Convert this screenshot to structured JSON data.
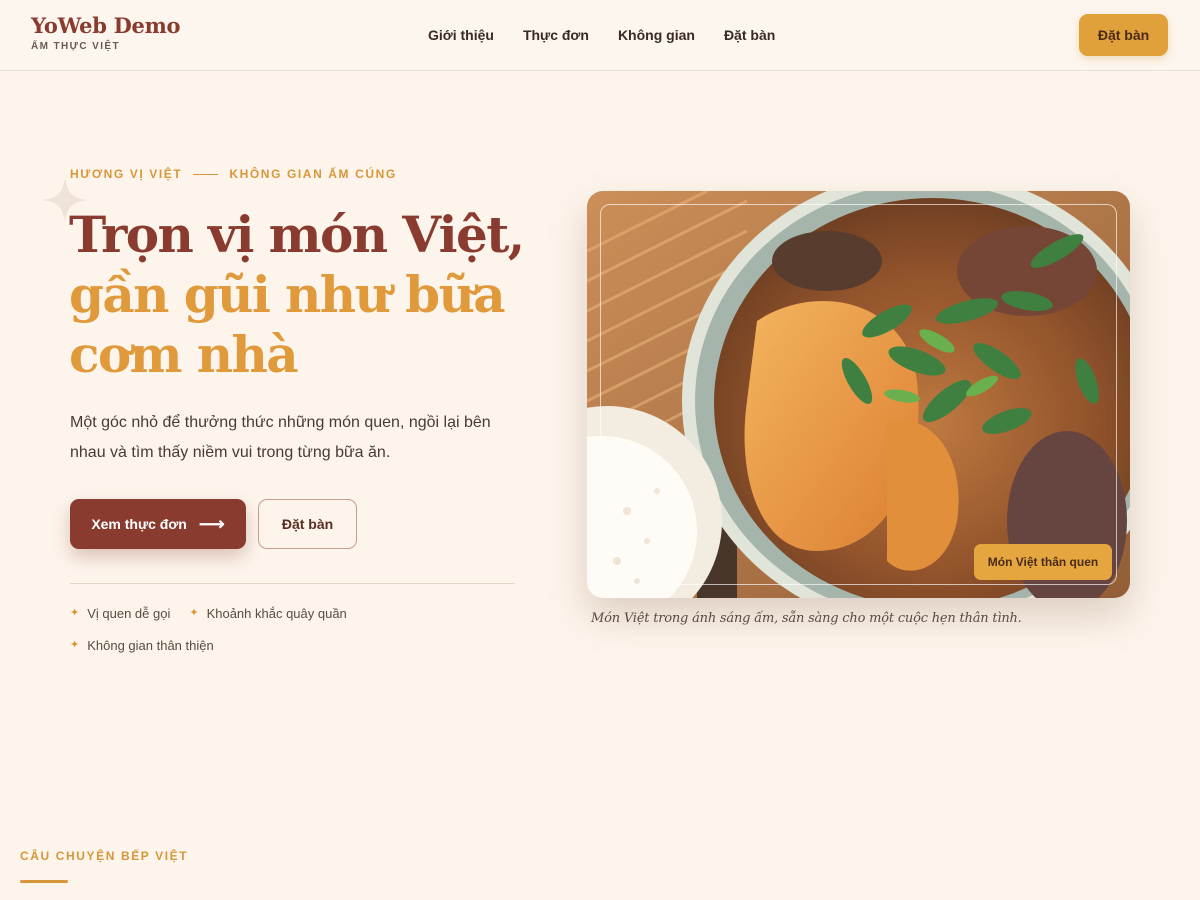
{
  "brand": {
    "name": "YoWeb Demo",
    "tagline": "ẨM THỰC VIỆT"
  },
  "nav": {
    "items": [
      "Giới thiệu",
      "Thực đơn",
      "Không gian",
      "Đặt bàn"
    ]
  },
  "header_cta": "Đặt bàn",
  "hero": {
    "eyebrow_left": "HƯƠNG VỊ VIỆT",
    "eyebrow_right": "KHÔNG GIAN ẤM CÚNG",
    "headline_line1": "Trọn vị món Việt,",
    "headline_line2": "gần gũi như bữa",
    "headline_line3": "cơm nhà",
    "lead": "Một góc nhỏ để thưởng thức những món quen, ngồi lại bên nhau và tìm thấy niềm vui trong từng bữa ăn.",
    "primary_button": "Xem thực đơn",
    "primary_arrow": "⟶",
    "secondary_button": "Đặt bàn",
    "features": [
      "Vị quen dễ gọi",
      "Khoảnh khắc quây quần",
      "Không gian thân thiện"
    ],
    "feature_icon": "✦",
    "photo_badge": "Món Việt thân quen",
    "photo_caption": "Món Việt trong ánh sáng ấm, sẵn sàng cho một cuộc hẹn thân tình."
  },
  "story": {
    "label": "CÂU CHUYỆN BẾP VIỆT"
  },
  "colors": {
    "background": "#fdf5ec",
    "brand_red": "#8a3b2f",
    "accent_gold": "#e0a03a",
    "text_dark": "#3b2a24"
  },
  "icons": {
    "sparkle": "sparkle-icon",
    "arrow": "arrow-right-icon",
    "feature": "star-bullet-icon"
  }
}
